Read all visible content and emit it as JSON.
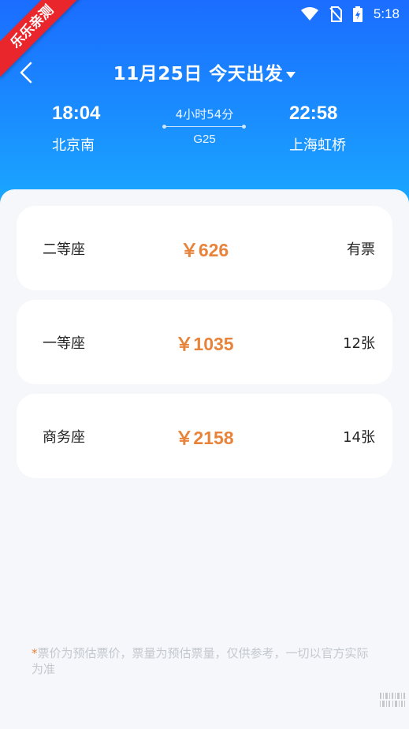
{
  "watermark": "乐乐亲测",
  "status_bar": {
    "time": "5:18"
  },
  "header": {
    "date_title": "11月25日 今天出发",
    "departure": {
      "time": "18:04",
      "station": "北京南"
    },
    "arrival": {
      "time": "22:58",
      "station": "上海虹桥"
    },
    "duration": "4小时54分",
    "train_no": "G25"
  },
  "seats": [
    {
      "name": "二等座",
      "price": "￥626",
      "availability": "有票"
    },
    {
      "name": "一等座",
      "price": "￥1035",
      "availability": "12张"
    },
    {
      "name": "商务座",
      "price": "￥2158",
      "availability": "14张"
    }
  ],
  "footer_note": {
    "star": "*",
    "text": "票价为预估票价，票量为预估票量，仅供参考，一切以官方实际为准"
  },
  "colors": {
    "header_blue": "#1b6dff",
    "price_orange": "#e7833a",
    "ribbon_red": "#e8262c"
  }
}
